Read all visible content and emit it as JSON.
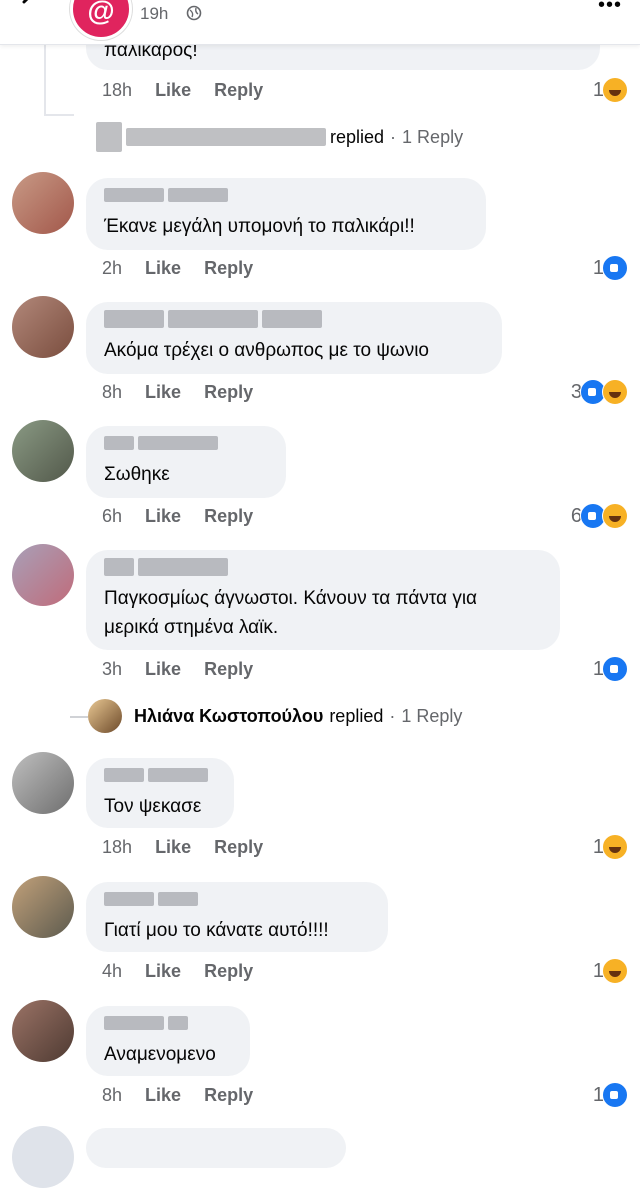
{
  "header": {
    "post_time": "19h",
    "back_icon": "chevron-left-icon",
    "globe_icon": "globe-icon",
    "more_icon": "more-icon"
  },
  "actions": {
    "like": "Like",
    "reply": "Reply"
  },
  "comments": [
    {
      "id": "c0",
      "text": "παλικαρος!",
      "time": "18h",
      "reaction_count": "1",
      "reactions": [
        "haha"
      ]
    },
    {
      "id": "r0",
      "type": "reply_summary",
      "replied": "replied",
      "sep": "·",
      "reply_count": "1 Reply"
    },
    {
      "id": "c1",
      "text": "Έκανε μεγάλη υπομονή το παλικάρι!!",
      "time": "2h",
      "reaction_count": "1",
      "reactions": [
        "like"
      ]
    },
    {
      "id": "c2",
      "text": "Ακόμα τρέχει ο ανθρωπος με το ψωνιο",
      "time": "8h",
      "reaction_count": "3",
      "reactions": [
        "like",
        "haha"
      ]
    },
    {
      "id": "c3",
      "text": "Σωθηκε",
      "time": "6h",
      "reaction_count": "6",
      "reactions": [
        "like",
        "haha"
      ]
    },
    {
      "id": "c4",
      "text": "Παγκοσμίως άγνωστοι. Κάνουν τα πάντα για\nμερικά στημένα  λαϊκ.",
      "time": "3h",
      "reaction_count": "1",
      "reactions": [
        "like"
      ]
    },
    {
      "id": "r1",
      "type": "reply_summary",
      "name": "Ηλιάνα Κωστοπούλου",
      "replied": "replied",
      "sep": "·",
      "reply_count": "1 Reply"
    },
    {
      "id": "c5",
      "text": "Τον ψεκασε",
      "time": "18h",
      "reaction_count": "1",
      "reactions": [
        "haha"
      ]
    },
    {
      "id": "c6",
      "text": "Γιατί μου το κάνατε αυτό!!!!",
      "time": "4h",
      "reaction_count": "1",
      "reactions": [
        "haha"
      ]
    },
    {
      "id": "c7",
      "text": "Αναμενομενο",
      "time": "8h",
      "reaction_count": "1",
      "reactions": [
        "like"
      ]
    }
  ],
  "colors": {
    "bubble": "#f0f2f5",
    "meta_text": "#65676b",
    "like_blue": "#1877f2",
    "haha_yellow": "#f7b125"
  }
}
